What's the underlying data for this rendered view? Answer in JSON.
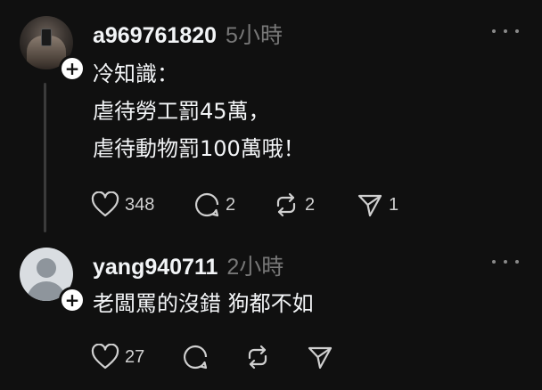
{
  "posts": [
    {
      "username": "a969761820",
      "timestamp": "5小時",
      "lines": [
        "冷知識：",
        "虐待勞工罰45萬，",
        "虐待動物罰100萬哦！"
      ],
      "counts": {
        "likes": "348",
        "comments": "2",
        "reposts": "2",
        "shares": "1"
      },
      "avatar": "photo-avatar",
      "follow_icon": "+"
    },
    {
      "username": "yang940711",
      "timestamp": "2小時",
      "lines": [
        "老闆罵的沒錯 狗都不如"
      ],
      "counts": {
        "likes": "27"
      },
      "avatar": "default-avatar",
      "follow_icon": "+"
    }
  ],
  "icons": [
    "heart-icon",
    "comment-icon",
    "repost-icon",
    "share-icon",
    "more-icon",
    "plus-icon"
  ],
  "colors": {
    "background": "#101010",
    "text_primary": "#f3f5f7",
    "text_secondary": "#777777",
    "thread_line": "#3b3b3b"
  }
}
